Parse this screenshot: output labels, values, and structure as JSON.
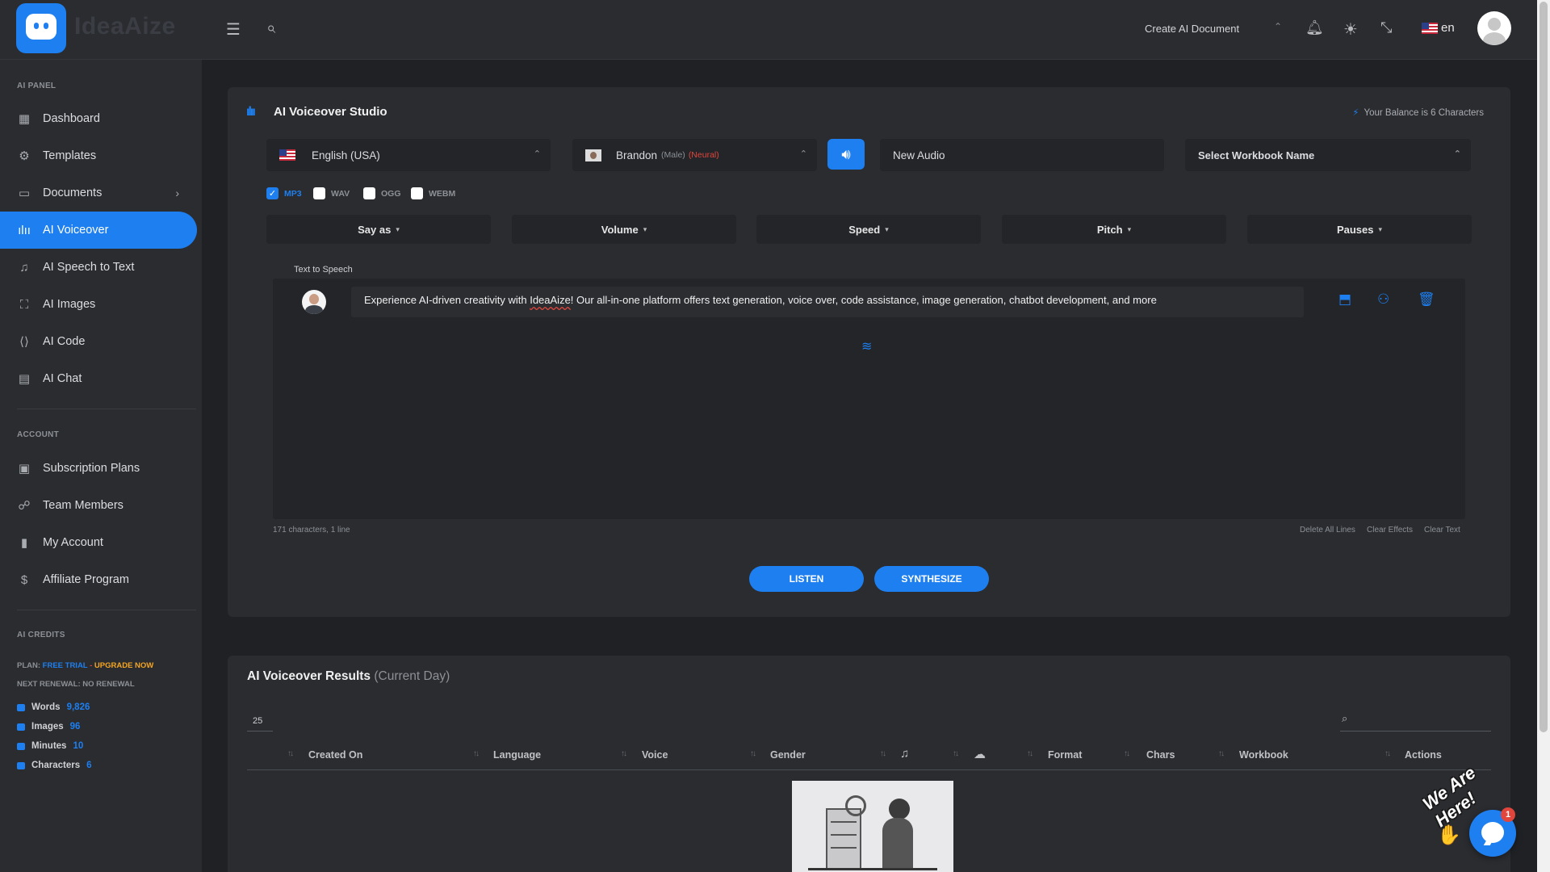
{
  "app": {
    "logo_text": "IdeaAize"
  },
  "topbar": {
    "create_doc_label": "Create AI Document",
    "language": "en"
  },
  "sidebar": {
    "panel_heading": "AI PANEL",
    "panel_items": [
      {
        "label": "Dashboard",
        "icon": "dashboard-icon"
      },
      {
        "label": "Templates",
        "icon": "templates-icon"
      },
      {
        "label": "Documents",
        "icon": "documents-icon"
      },
      {
        "label": "AI Voiceover",
        "icon": "voiceover-icon"
      },
      {
        "label": "AI Speech to Text",
        "icon": "speech-to-text-icon"
      },
      {
        "label": "AI Images",
        "icon": "images-icon"
      },
      {
        "label": "AI Code",
        "icon": "code-icon"
      },
      {
        "label": "AI Chat",
        "icon": "chat-icon"
      }
    ],
    "account_heading": "ACCOUNT",
    "account_items": [
      {
        "label": "Subscription Plans",
        "icon": "subscription-icon"
      },
      {
        "label": "Team Members",
        "icon": "team-icon"
      },
      {
        "label": "My Account",
        "icon": "account-icon"
      },
      {
        "label": "Affiliate Program",
        "icon": "affiliate-icon"
      }
    ],
    "credits_heading": "AI CREDITS",
    "plan_prefix": "PLAN:",
    "plan_name": "FREE TRIAL",
    "plan_sep": " - ",
    "upgrade_label": "UPGRADE NOW",
    "renewal_label": "NEXT RENEWAL: NO RENEWAL",
    "credits": [
      {
        "label": "Words",
        "value": "9,826"
      },
      {
        "label": "Images",
        "value": "96"
      },
      {
        "label": "Minutes",
        "value": "10"
      },
      {
        "label": "Characters",
        "value": "6"
      }
    ]
  },
  "studio": {
    "title": "AI Voiceover Studio",
    "balance": "Your Balance is 6 Characters",
    "language_value": "English (USA)",
    "voice_name": "Brandon",
    "voice_gender": "(Male)",
    "voice_type": "(Neural)",
    "audio_name_value": "New Audio",
    "workbook_placeholder": "Select Workbook Name",
    "formats": [
      {
        "label": "MP3",
        "checked": true
      },
      {
        "label": "WAV",
        "checked": false
      },
      {
        "label": "OGG",
        "checked": false
      },
      {
        "label": "WEBM",
        "checked": false
      }
    ],
    "effects": [
      "Say as",
      "Volume",
      "Speed",
      "Pitch",
      "Pauses"
    ],
    "tts_label": "Text to Speech",
    "line_text_pre": "Experience AI-driven creativity with ",
    "line_text_brand": "IdeaAize",
    "line_text_post": "! Our all-in-one platform offers text generation, voice over, code assistance, image generation, chatbot development, and more",
    "char_count": "171 characters, 1 line",
    "footer_links": [
      "Delete All Lines",
      "Clear Effects",
      "Clear Text"
    ],
    "listen_label": "LISTEN",
    "synthesize_label": "SYNTHESIZE"
  },
  "results": {
    "title": "AI Voiceover Results",
    "subtitle": "(Current Day)",
    "page_length": "25",
    "columns": [
      "Created On",
      "Language",
      "Voice",
      "Gender",
      "Format",
      "Chars",
      "Workbook",
      "Actions"
    ]
  },
  "chat_widget": {
    "tagline": "We Are Here!",
    "badge_count": "1"
  }
}
